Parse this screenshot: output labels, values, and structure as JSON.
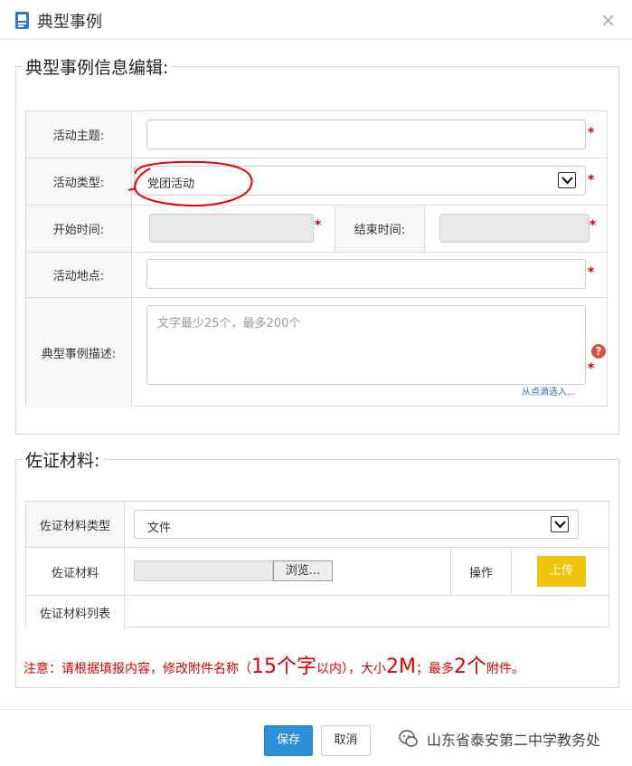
{
  "dialog": {
    "title": "典型事例",
    "close": "×"
  },
  "section1": {
    "legend": "典型事例信息编辑:",
    "topic_label": "活动主题:",
    "type_label": "活动类型:",
    "type_value": "党团活动",
    "start_label": "开始时间:",
    "end_label": "结束时间:",
    "location_label": "活动地点:",
    "desc_label": "典型事例描述:",
    "desc_placeholder": "文字最少25个，最多200个",
    "help": "?",
    "pick_link": "从点滴选入...",
    "required": "*"
  },
  "section2": {
    "legend": "佐证材料:",
    "material_type_label": "佐证材料类型",
    "material_type_value": "文件",
    "material_label": "佐证材料",
    "browse_label": "浏览...",
    "op_label": "操作",
    "upload_label": "上传",
    "list_label": "佐证材料列表"
  },
  "notice": {
    "p1": "注意：请根据填报内容，修改附件名称（",
    "big1": "15个字",
    "p2": "以内），大小",
    "big2": "2M",
    "p3": "；最多",
    "big3": "2个",
    "p4": "附件。"
  },
  "footer": {
    "save": "保存",
    "cancel": "取消",
    "watermark": "山东省泰安第二中学教务处"
  },
  "colors": {
    "save_button": "#2d8fd6",
    "upload_button": "#f0c40d",
    "required": "#dd0000",
    "notice": "#e00000"
  }
}
